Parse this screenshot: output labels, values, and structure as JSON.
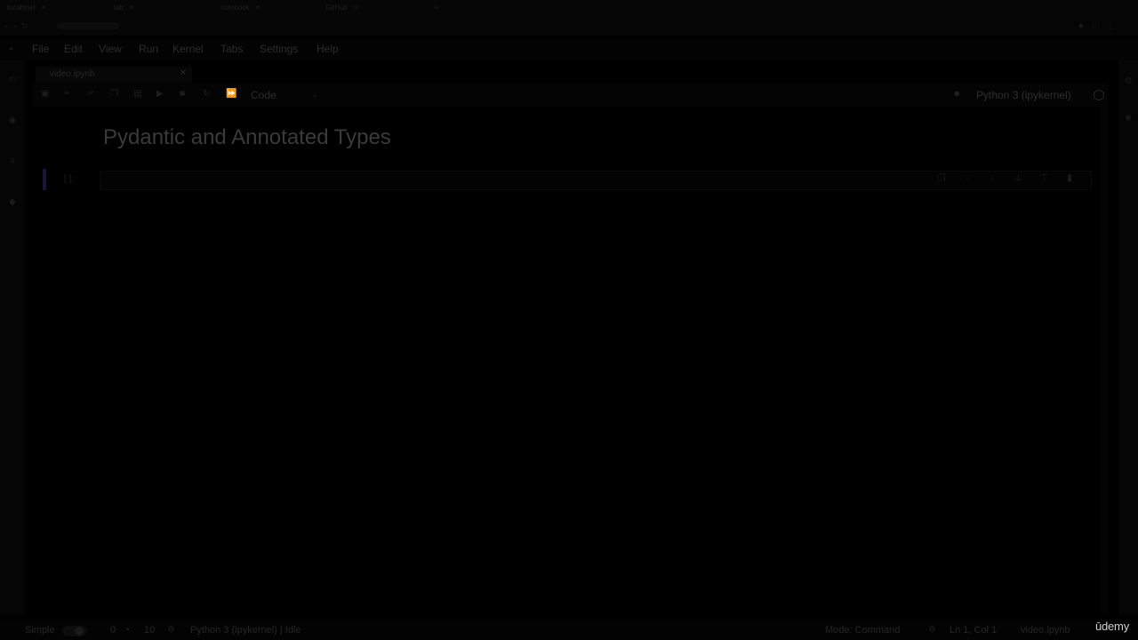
{
  "browser": {
    "tabs": [
      {
        "label": "localhost"
      },
      {
        "label": "lab"
      },
      {
        "label": "notebook"
      },
      {
        "label": "GitHub"
      }
    ],
    "new_tab_icon": "plus-icon"
  },
  "menubar": {
    "items": [
      "File",
      "Edit",
      "View",
      "Run",
      "Kernel",
      "Tabs",
      "Settings",
      "Help"
    ]
  },
  "file_tab": {
    "label": "video.ipynb",
    "close_icon": "close-icon"
  },
  "toolbar": {
    "cell_type": "Code",
    "kernel_name": "Python 3 (ipykernel)"
  },
  "notebook": {
    "heading": "Pydantic and Annotated Types",
    "cell_prompt": "[ ]:"
  },
  "statusbar": {
    "simple_label": "Simple",
    "count_a": "0",
    "count_b": "10",
    "kernel": "Python 3 (ipykernel) | Idle",
    "mode": "Mode: Command",
    "position": "Ln 1, Col 1",
    "filename": "video.ipynb"
  },
  "watermark": "ūdemy",
  "colors": {
    "background": "#000000",
    "cell_marker": "#16163a"
  }
}
